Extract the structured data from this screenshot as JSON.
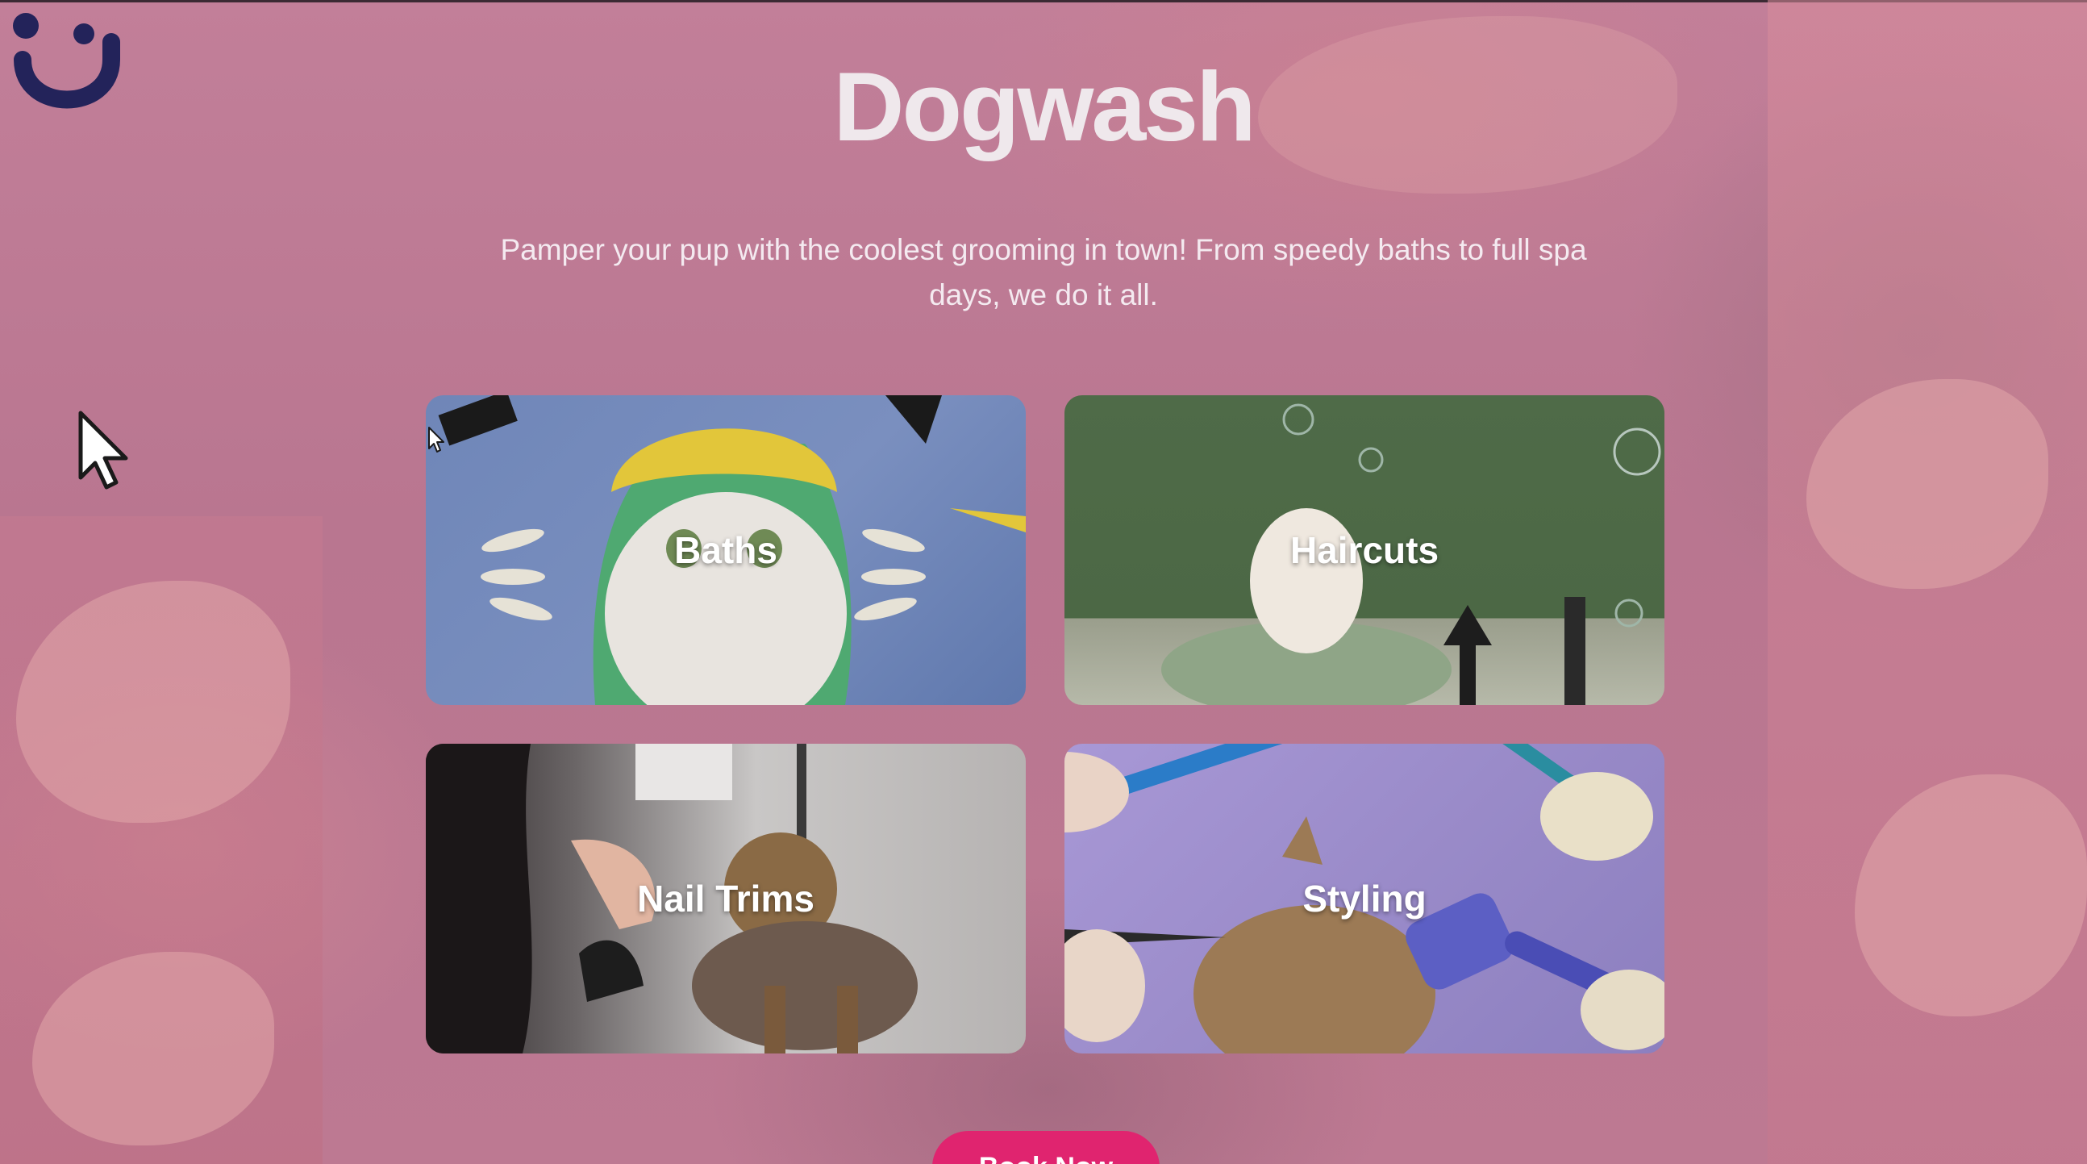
{
  "site": {
    "title": "Dogwash",
    "tagline": "Pamper your pup with the coolest grooming in town! From speedy baths to full spa days, we do it all."
  },
  "services": [
    {
      "label": "Baths"
    },
    {
      "label": "Haircuts"
    },
    {
      "label": "Nail Trims"
    },
    {
      "label": "Styling"
    }
  ],
  "cta": {
    "label": "Book Now"
  },
  "colors": {
    "overlay": "#b87590",
    "title_text": "#efe8ec",
    "cta_background": "#e0246f",
    "logo": "#23235a"
  },
  "icons": {
    "logo": "smiley-logo-icon",
    "cursor": "mouse-pointer-icon"
  }
}
